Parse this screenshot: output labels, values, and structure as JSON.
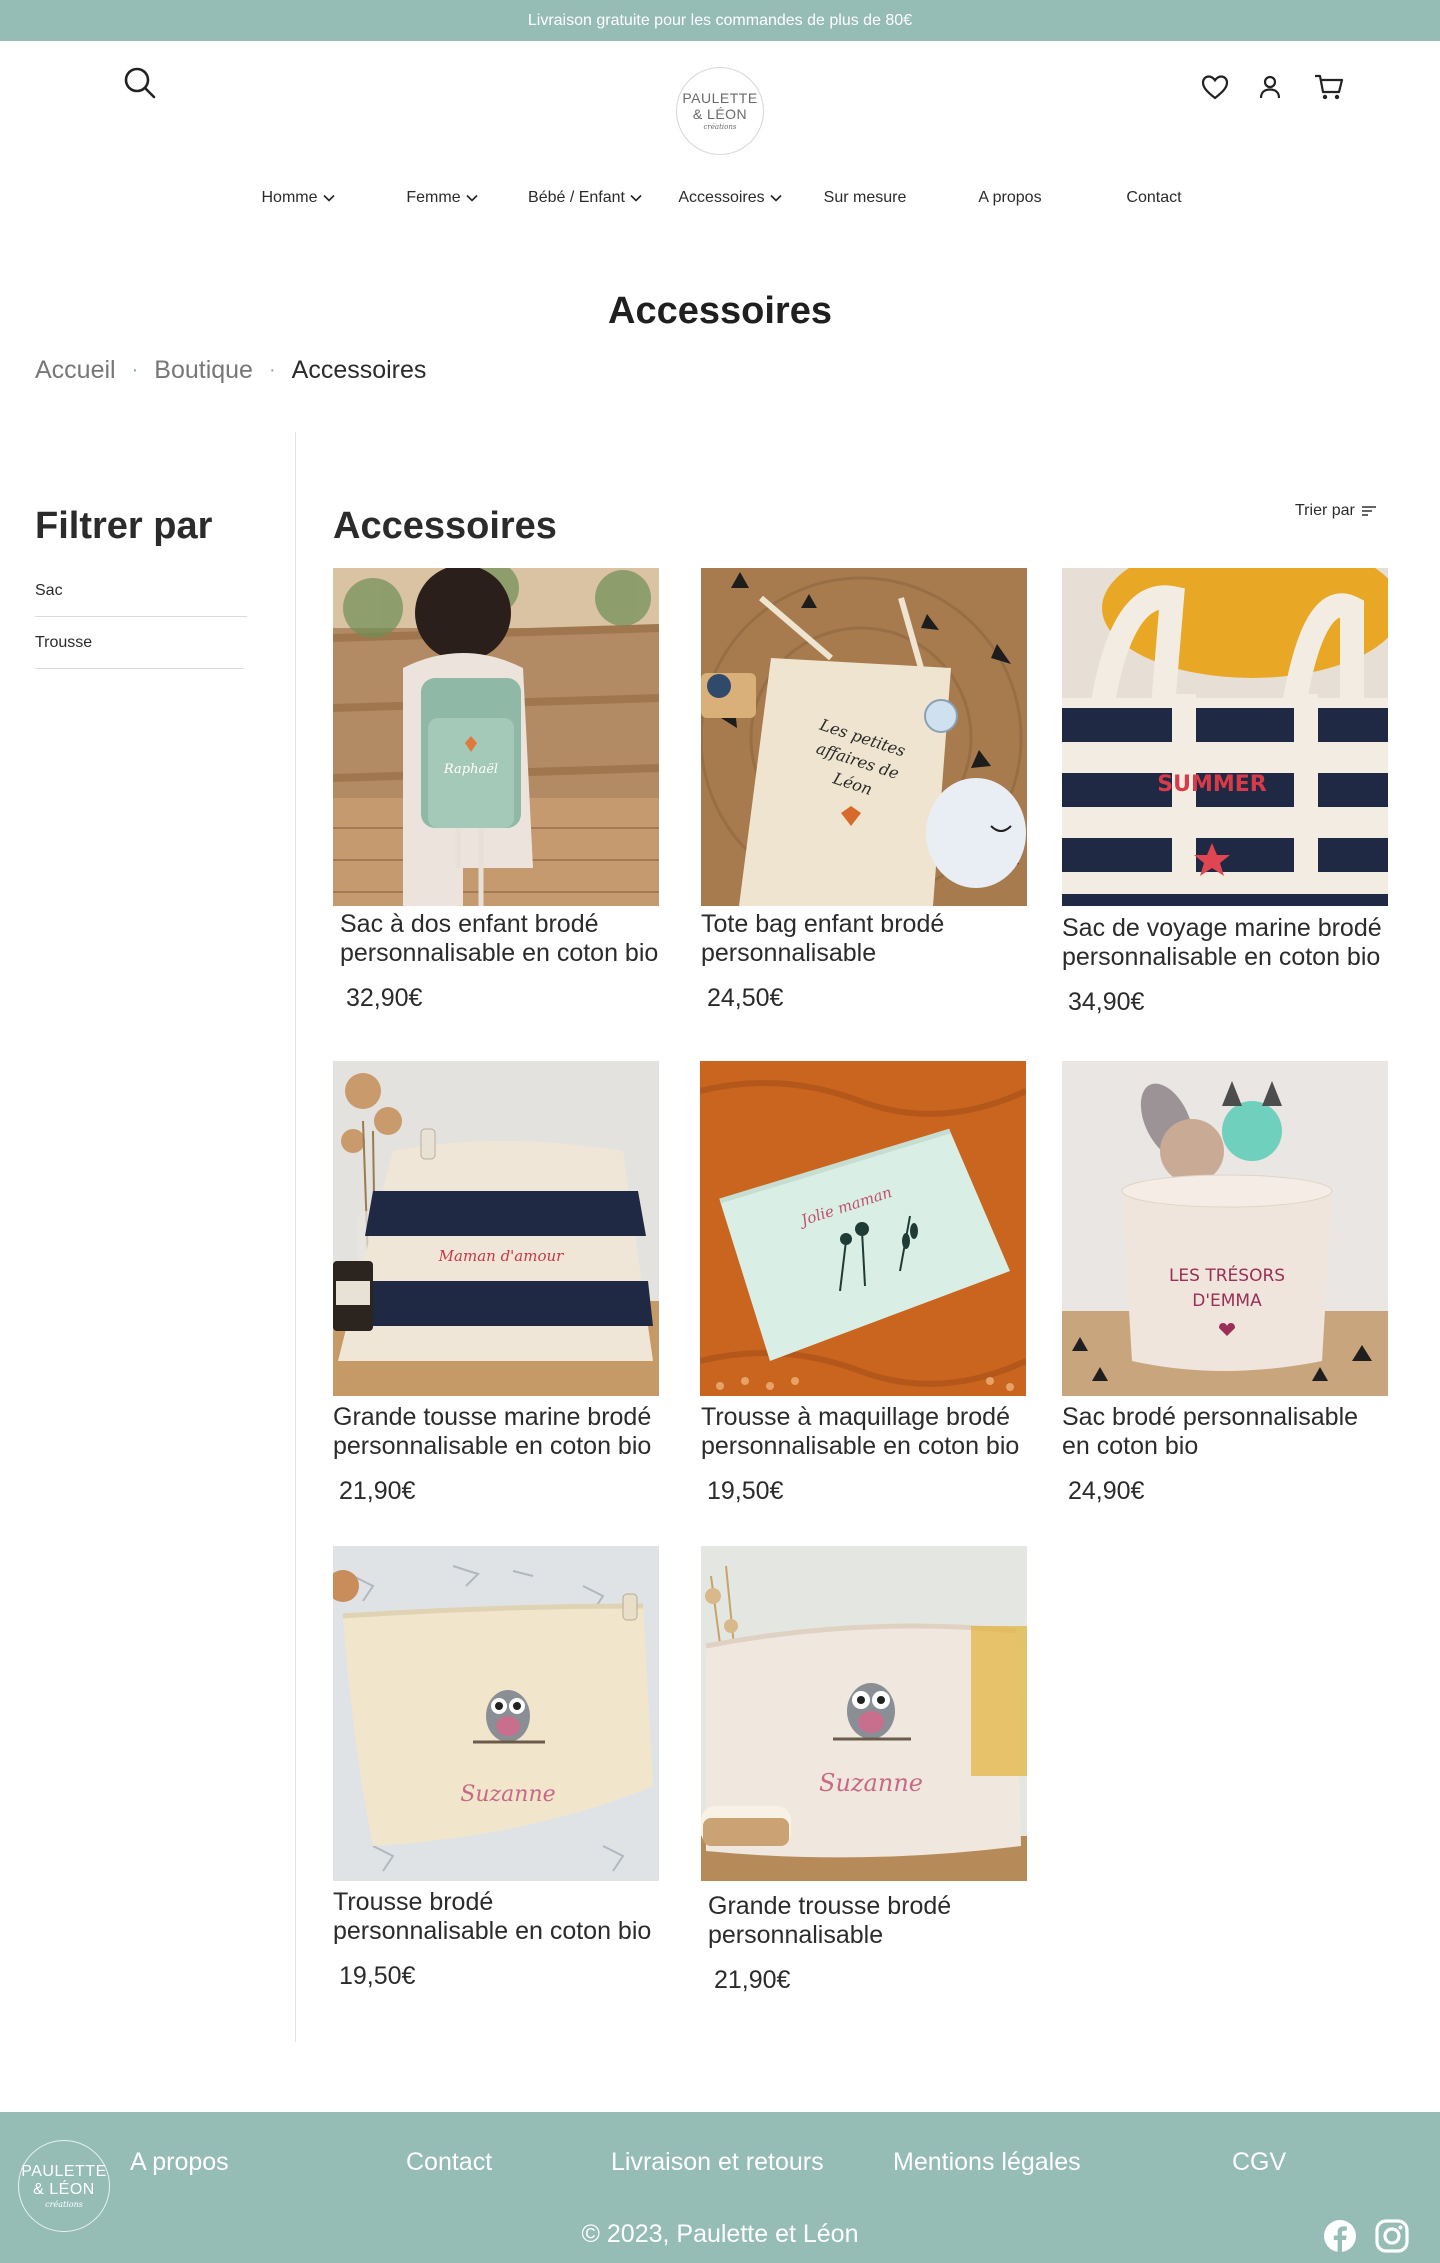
{
  "announcement": "Livraison gratuite pour les commandes de plus de 80€",
  "header": {
    "logo": {
      "line1": "PAULETTE",
      "line2": "& LÉON",
      "line3": "créations"
    }
  },
  "nav": [
    {
      "label": "Homme",
      "dropdown": true
    },
    {
      "label": "Femme",
      "dropdown": true
    },
    {
      "label": "Bébé / Enfant",
      "dropdown": true
    },
    {
      "label": "Accessoires",
      "dropdown": true
    },
    {
      "label": "Sur mesure",
      "dropdown": false
    },
    {
      "label": "A propos",
      "dropdown": false
    },
    {
      "label": "Contact",
      "dropdown": false
    }
  ],
  "page_title": "Accessoires",
  "breadcrumb": {
    "home": "Accueil",
    "shop": "Boutique",
    "current": "Accessoires",
    "separator": "·"
  },
  "filters": {
    "title": "Filtrer par",
    "items": [
      "Sac",
      "Trousse"
    ]
  },
  "catalog": {
    "title": "Accessoires",
    "sort_label": "Trier par",
    "products": [
      {
        "name": "Sac à dos enfant brodé personnalisable en coton bio",
        "price": "32,90€",
        "image_text": "Raphaël"
      },
      {
        "name": "Tote bag enfant brodé personnalisable",
        "price": "24,50€",
        "image_text": "Les petites affaires de Léon"
      },
      {
        "name": "Sac de voyage marine brodé personnalisable en coton bio",
        "price": "34,90€",
        "image_text": "SUMMER"
      },
      {
        "name": "Grande tousse marine brodé personnalisable en coton bio",
        "price": "21,90€",
        "image_text": "Maman d'amour"
      },
      {
        "name": "Trousse à maquillage brodé personnalisable en coton bio",
        "price": "19,50€",
        "image_text": "Jolie maman"
      },
      {
        "name": "Sac brodé personnalisable en coton bio",
        "price": "24,90€",
        "image_text": "LES TRÉSORS D'EMMA"
      },
      {
        "name": "Trousse brodé personnalisable en coton bio",
        "price": "19,50€",
        "image_text": "Suzanne"
      },
      {
        "name": "Grande trousse brodé personnalisable",
        "price": "21,90€",
        "image_text": "Suzanne"
      }
    ]
  },
  "footer": {
    "logo": {
      "line1": "PAULETTE",
      "line2": "& LÉON",
      "line3": "créations"
    },
    "links": [
      "A propos",
      "Contact",
      "Livraison et retours",
      "Mentions légales",
      "CGV"
    ],
    "copyright": "© 2023, Paulette et Léon",
    "social": [
      "facebook-icon",
      "instagram-icon"
    ]
  },
  "colors": {
    "brand": "#95bdb6",
    "text": "#2b2b2b",
    "muted": "#777777"
  },
  "icons": [
    "search-icon",
    "heart-icon",
    "account-icon",
    "cart-icon",
    "chevron-down-icon",
    "sort-icon"
  ]
}
